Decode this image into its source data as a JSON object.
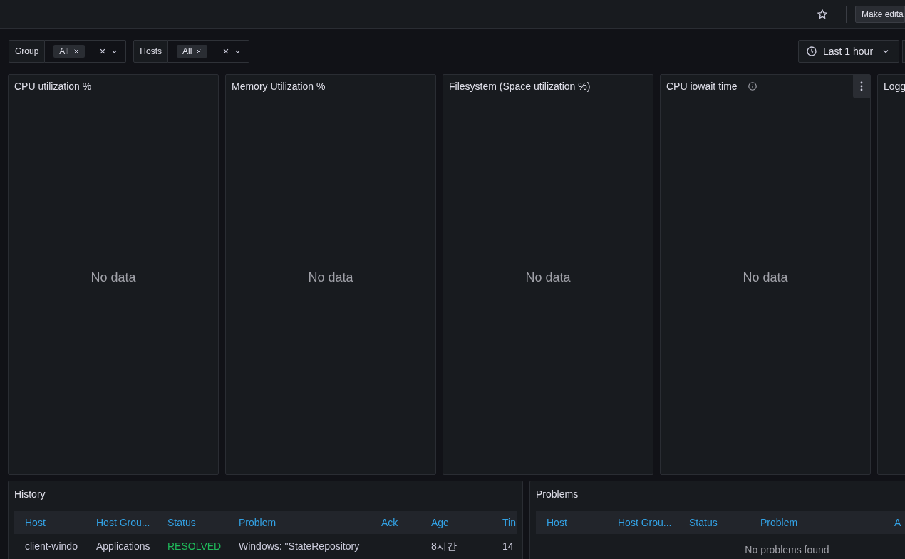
{
  "toolbar": {
    "make_editable": "Make edita"
  },
  "filters": [
    {
      "label": "Group",
      "value": "All"
    },
    {
      "label": "Hosts",
      "value": "All"
    }
  ],
  "time_picker": {
    "label": "Last 1 hour"
  },
  "panels": [
    {
      "title": "CPU utilization %",
      "message": "No data",
      "info": false,
      "menu": false
    },
    {
      "title": "Memory Utilization %",
      "message": "No data",
      "info": false,
      "menu": false
    },
    {
      "title": "Filesystem (Space utilization %)",
      "message": "No data",
      "info": false,
      "menu": false
    },
    {
      "title": "CPU iowait time",
      "message": "No data",
      "info": true,
      "menu": true
    },
    {
      "title": "Logg"
    }
  ],
  "history": {
    "title": "History",
    "columns": [
      "Host",
      "Host Grou...",
      "Status",
      "Problem",
      "Ack",
      "Age",
      "Tin"
    ],
    "rows": [
      [
        {
          "text": "client-windo",
          "kind": "plain"
        },
        {
          "text": "Applications",
          "kind": "plain"
        },
        {
          "text": "RESOLVED",
          "kind": "resolved"
        },
        {
          "text": "Windows: \"StateRepository",
          "kind": "plain"
        },
        {
          "text": "",
          "kind": "plain"
        },
        {
          "text": "8시간",
          "kind": "plain"
        },
        {
          "text": "14",
          "kind": "plain"
        }
      ]
    ]
  },
  "problems": {
    "title": "Problems",
    "columns": [
      "Host",
      "Host Grou...",
      "Status",
      "Problem",
      "A"
    ],
    "message": "No problems found"
  }
}
